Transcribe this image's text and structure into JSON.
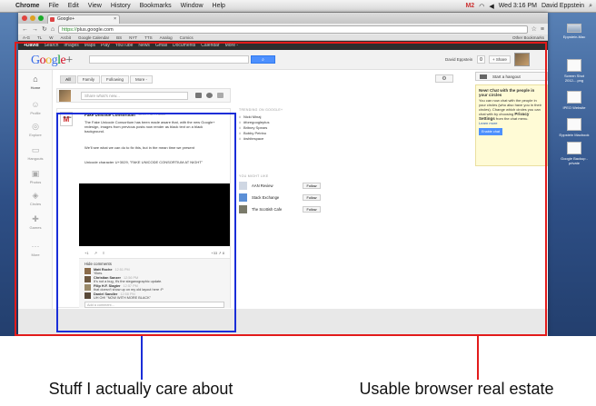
{
  "mac_menubar": {
    "app": "Chrome",
    "items": [
      "File",
      "Edit",
      "View",
      "History",
      "Bookmarks",
      "Window",
      "Help"
    ],
    "clock": "Wed 3:16 PM",
    "user": "David Eppstein",
    "gmail_count": "2"
  },
  "browser": {
    "tab_title": "Google+",
    "url_scheme": "https://",
    "url_host": "plus.google.com",
    "bookmarks": [
      "A-G",
      "TL",
      "W",
      "Arcbit",
      "Google Calendar",
      "BS",
      "NYT",
      "TTS",
      "Analog",
      "Comics"
    ],
    "bookmarks_right": "Other Bookmarks"
  },
  "gbar": {
    "items": [
      "+David",
      "Search",
      "Images",
      "Maps",
      "Play",
      "YouTube",
      "News",
      "Gmail",
      "Documents",
      "Calendar",
      "More -"
    ]
  },
  "header": {
    "logo": "Google+",
    "user": "David Eppstein",
    "notif_count": "0",
    "share_label": "+ Share"
  },
  "leftnav": [
    {
      "label": "Home",
      "glyph": "⌂",
      "active": true
    },
    {
      "label": "Profile",
      "glyph": "☺",
      "active": false
    },
    {
      "label": "Explore",
      "glyph": "◎",
      "active": false
    },
    {
      "label": "Hangouts",
      "glyph": "▭",
      "active": false
    },
    {
      "label": "Photos",
      "glyph": "▣",
      "active": false
    },
    {
      "label": "Circles",
      "glyph": "◈",
      "active": false
    },
    {
      "label": "Games",
      "glyph": "✚",
      "active": false
    },
    {
      "label": "More",
      "glyph": "···",
      "active": false
    }
  ],
  "filters": [
    "All",
    "Family",
    "Following",
    "More -"
  ],
  "sharebox": {
    "placeholder": "Share what's new..."
  },
  "post": {
    "author": "Fake Unicode Consortium",
    "time": "12:37 PM - Public",
    "para1": "The Fake Unicode Consortium has been made aware that, with the new Google+ redesign, images from previous posts now render as black text on a black background.",
    "para2": "We'll see what we can do to fix this, but in the mean time we present",
    "para3": "Unicode character U+3029, \"FAKE UNICODE CONSORTIUM AT NIGHT\"",
    "actions": [
      "+1",
      "↗",
      "≡"
    ],
    "counts": "+33 ↗ 8",
    "hide_comments": "Hide comments",
    "comments": [
      {
        "name": "Matt Roche",
        "time": "12:51 PM",
        "text": "Yikes."
      },
      {
        "name": "Christian Sanzer",
        "time": "12:56 PM",
        "text": "It's not a bug, it's the steganographic update."
      },
      {
        "name": "Filip H.F. Slagter",
        "time": "12:57 PM",
        "text": "that doesn't show up on my old layout here :P"
      },
      {
        "name": "Daniel Sandler",
        "time": "12:58 PM",
        "text": "UH OH! \"NOW WITH MORE BLACK\""
      }
    ],
    "add_comment": "Add a comment..."
  },
  "trending": {
    "heading": "TRENDING ON GOOGLE+",
    "items": [
      "Nicki Minaj",
      "#foregoogleplus",
      "Britney Spears",
      "Bobby Petrino",
      "#whitespace"
    ]
  },
  "you_might_like": {
    "heading": "YOU MIGHT LIKE",
    "items": [
      {
        "name": "AAN Review",
        "button": "Follow"
      },
      {
        "name": "Stack Exchange",
        "button": "Follow"
      },
      {
        "name": "The Scottish Cafe",
        "button": "Follow"
      }
    ]
  },
  "hangout": {
    "start": "Start a hangout",
    "title": "New! Chat with the people in your circles",
    "body1": "You can now chat with the people in your circles (who also have you in their circles). Change which circles you can chat with by choosing",
    "body_bold": "Privacy Settings",
    "body2": "from the chat menu.",
    "learn_more": "Learn more",
    "enable": "Enable chat"
  },
  "desktop_icons": [
    {
      "label": "Eppstein-Mac"
    },
    {
      "label": "Screen Shot 2012-...png"
    },
    {
      "label": "IPEO Website"
    },
    {
      "label": "Eppstein Macbook"
    },
    {
      "label": "Google Backup - private"
    }
  ],
  "annotations": {
    "left": "Stuff I actually care about",
    "right": "Usable browser real estate",
    "left_color": "#1a2ed8",
    "right_color": "#e21b1b"
  }
}
